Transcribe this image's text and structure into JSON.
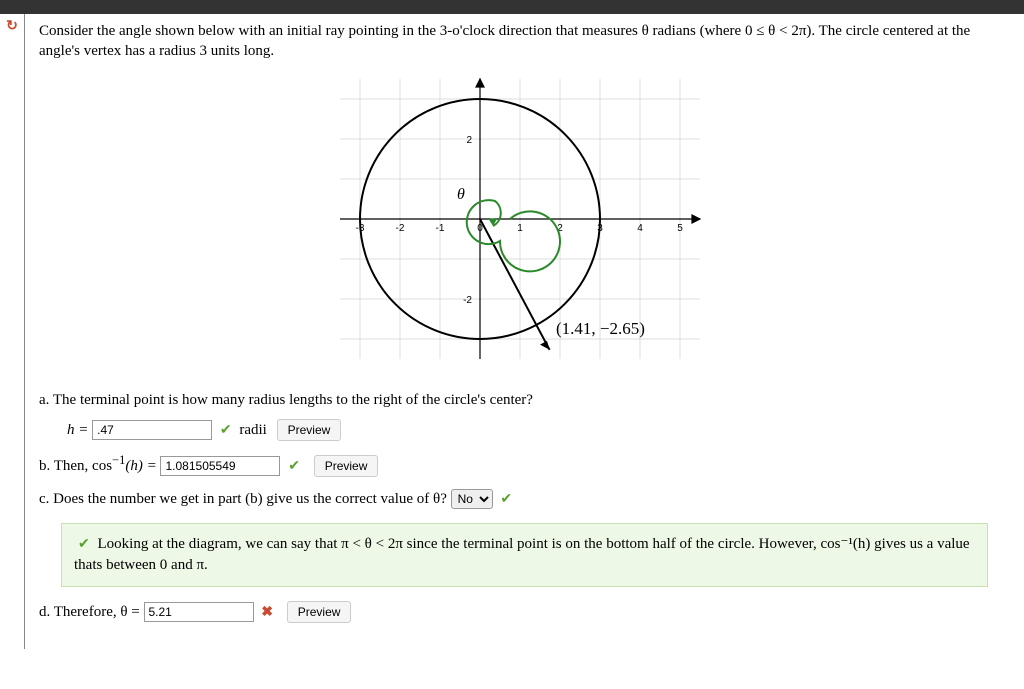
{
  "problem": {
    "intro": "Consider the angle shown below with an initial ray pointing in the 3-o'clock direction that measures θ radians (where 0 ≤ θ < 2π). The circle centered at the angle's vertex has a radius 3 units long."
  },
  "chart_data": {
    "type": "diagram",
    "circle": {
      "center": [
        0,
        0
      ],
      "radius": 3
    },
    "axes": {
      "x_range": [
        -3.5,
        5.5
      ],
      "y_range": [
        -3.5,
        3.5
      ],
      "x_ticks": [
        -3,
        -2,
        -1,
        0,
        1,
        2,
        3,
        4,
        5
      ],
      "y_ticks": [
        -3,
        -2,
        -1,
        1,
        2,
        3
      ],
      "visible_x_labels": [
        "-3",
        "-2",
        "-1",
        "0",
        "1",
        "2",
        "3",
        "4",
        "5"
      ],
      "visible_y_labels": [
        "-2",
        "2"
      ]
    },
    "initial_ray": {
      "from": [
        0,
        0
      ],
      "to": [
        5,
        0
      ]
    },
    "terminal_ray": {
      "from": [
        0,
        0
      ],
      "through_point": [
        1.41,
        -2.65
      ]
    },
    "terminal_point_label": "(1.41, −2.65)",
    "angle_label": "θ",
    "angle_arc": {
      "direction": "ccw",
      "from_angle_deg": 0,
      "to_angle_deg": 298,
      "color": "#2a8a2a"
    }
  },
  "parts": {
    "a": {
      "text": "a. The terminal point is how many radius lengths to the right of the circle's center?",
      "label_prefix": "h = ",
      "value": ".47",
      "unit_text": " radii   ",
      "status": "correct",
      "preview": "Preview"
    },
    "b": {
      "prefix": "b. Then, cos",
      "sup": "−1",
      "mid": "(h) = ",
      "value": "1.081505549",
      "status": "correct",
      "preview": "Preview"
    },
    "c": {
      "text_before": "c. Does the number we get in part (b) give us the correct value of θ?",
      "selected": "No",
      "status": "correct"
    },
    "explain": "Looking at the diagram, we can say that π < θ < 2π since the terminal point is on the bottom half of the circle. However, cos⁻¹(h) gives us a value thats between 0 and π.",
    "d": {
      "prefix": "d. Therefore, θ = ",
      "value": "5.21",
      "status": "wrong",
      "preview": "Preview"
    }
  }
}
